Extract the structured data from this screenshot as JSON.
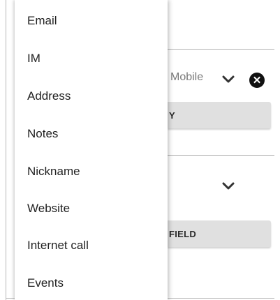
{
  "form": {
    "phone_type": "Mobile",
    "clear_icon": "close-circle-icon",
    "chevron_icon": "chevron-down-icon",
    "add_button_1_label": "Y",
    "add_button_2_label": "FIELD"
  },
  "menu": {
    "items": [
      {
        "label": "Email"
      },
      {
        "label": "IM"
      },
      {
        "label": "Address"
      },
      {
        "label": "Notes"
      },
      {
        "label": "Nickname"
      },
      {
        "label": "Website"
      },
      {
        "label": "Internet call"
      },
      {
        "label": "Events"
      }
    ]
  }
}
